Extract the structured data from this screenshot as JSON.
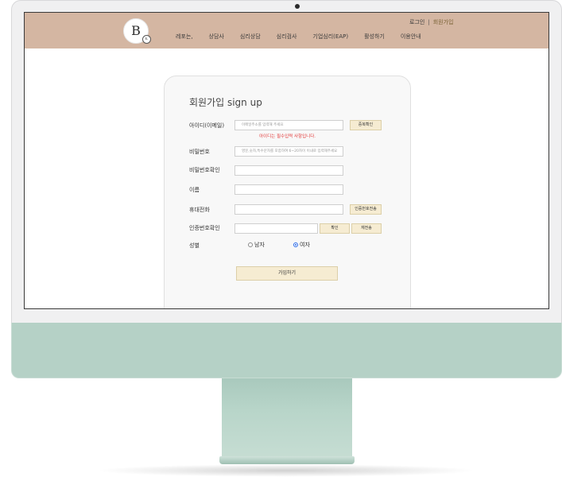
{
  "header": {
    "logo_letter": "B",
    "logo_badge": "s.",
    "top_links": {
      "login": "로그인",
      "separator": "|",
      "signup": "회원가입"
    },
    "nav": [
      "레포는,",
      "상담사",
      "심리상담",
      "심리검사",
      "기업심리(EAP)",
      "활성하기",
      "이용안내"
    ]
  },
  "form": {
    "title": "회원가입 sign up",
    "id_label": "아이디(이메일)",
    "id_placeholder": "이메일주소를 입력해 주세요",
    "id_check_button": "중복확인",
    "id_error": "아이디는 필수입력 사항입니다.",
    "password_label": "비밀번호",
    "password_placeholder": "영문,숫자,특수문자를 포함하여 6~20자이 이내로 입력해주세요",
    "password_confirm_label": "비밀번호확인",
    "name_label": "이름",
    "phone_label": "휴대전화",
    "send_code_button": "인증번호전송",
    "code_label": "인증번호확인",
    "confirm_button": "확인",
    "resend_button": "재전송",
    "gender_label": "성별",
    "gender_male": "남자",
    "gender_female": "여자",
    "gender_selected": "여자",
    "submit_button": "가입하기"
  },
  "colors": {
    "header_bg": "#d4b6a2",
    "button_bg": "#f6ecd2",
    "error": "#e23a3a",
    "monitor_chin": "#b5d1c6"
  }
}
